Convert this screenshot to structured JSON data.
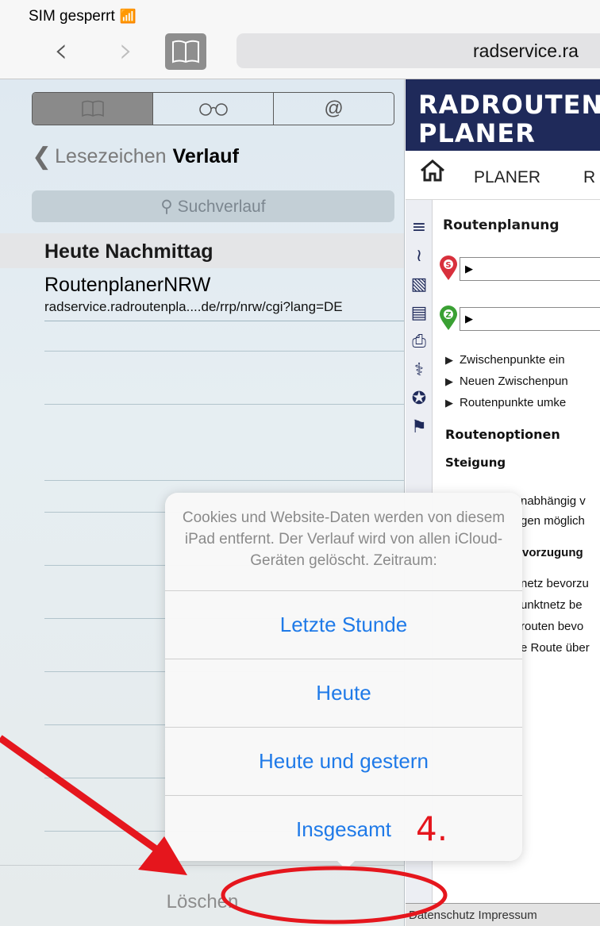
{
  "status_bar": {
    "carrier": "SIM gesperrt"
  },
  "browser": {
    "url": "radservice.ra"
  },
  "sidebar": {
    "tabs": [
      {
        "icon": "book-icon",
        "label": "Lesezeichen",
        "active": true
      },
      {
        "icon": "reading-glasses-icon",
        "label": "Leseliste",
        "active": false
      },
      {
        "icon": "at-icon",
        "label": "Links",
        "active": false
      }
    ],
    "back_label": "Lesezeichen",
    "title": "Verlauf",
    "search_placeholder": "Suchverlauf",
    "section_header": "Heute Nachmittag",
    "history": [
      {
        "title": "RoutenplanerNRW",
        "url": "radservice.radroutenpla....de/rrp/nrw/cgi?lang=DE"
      }
    ],
    "clear_button": "Löschen"
  },
  "website": {
    "header": "RADROUTEN\nPLANER",
    "menu": {
      "item1": "PLANER",
      "item2": "R"
    },
    "section_title": "Routenplanung",
    "start_pin": "S",
    "end_pin": "Z",
    "links": [
      "Zwischenpunkte ein",
      "Neuen Zwischenpun",
      "Routenpunkte umke"
    ],
    "options_title": "Routenoptionen",
    "slope_label": "Steigung",
    "slope_lines": [
      "nabhängig v",
      "gen möglich"
    ],
    "preference_heading": "vorzugung",
    "preference_lines": [
      "netz bevorzu",
      "unktnetz be",
      "routen bevo",
      "e Route über"
    ],
    "footer": "Datenschutz  Impressum"
  },
  "popover": {
    "message": "Cookies und Website-Daten werden von diesem iPad entfernt. Der Verlauf wird von allen iCloud-Geräten gelöscht. Zeitraum:",
    "options": [
      "Letzte Stunde",
      "Heute",
      "Heute und gestern",
      "Insgesamt"
    ],
    "accent_color": "#1f7ae8"
  },
  "annotation": {
    "step": "4.",
    "color": "#e5161d"
  }
}
